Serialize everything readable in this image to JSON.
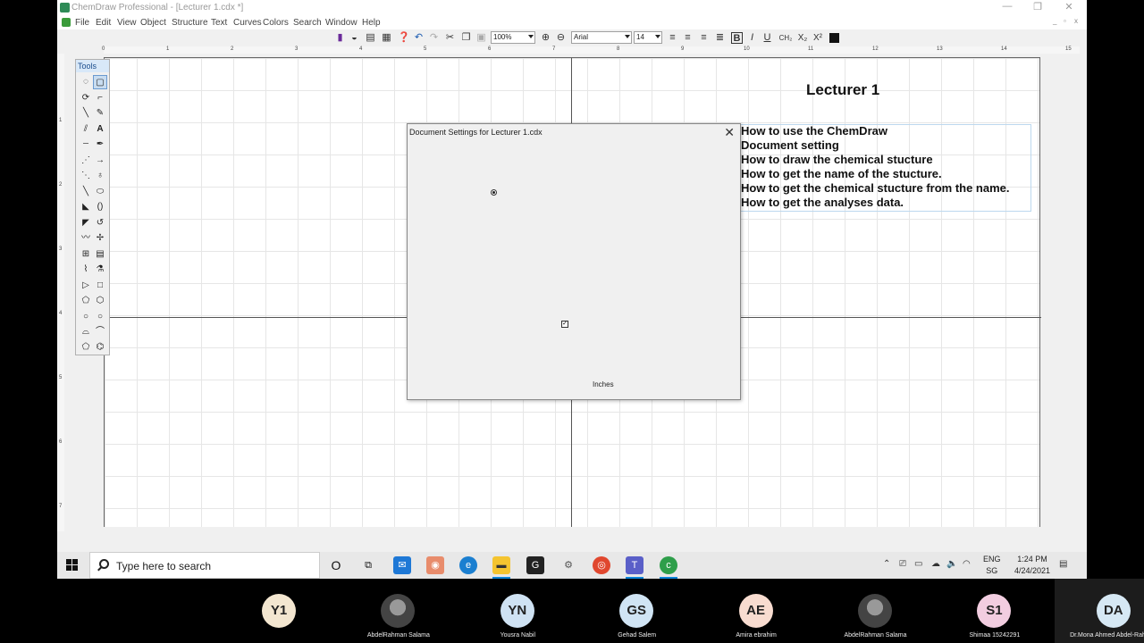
{
  "window": {
    "title": "ChemDraw Professional - [Lecturer 1.cdx *]",
    "controls": [
      "—",
      "❐",
      "✕"
    ]
  },
  "menu": [
    "File",
    "Edit",
    "View",
    "Object",
    "Structure",
    "Text",
    "Curves",
    "Colors",
    "Search",
    "Window",
    "Help"
  ],
  "toolbar": {
    "zoom": "100%",
    "font": "Arial",
    "size": "14",
    "style_bold": "B",
    "style_italic": "I",
    "style_underline": "U",
    "style_formula": "CH₂",
    "style_sub": "X₂",
    "style_sup": "X²"
  },
  "ruler": {
    "h": [
      "0",
      "1",
      "2",
      "3",
      "4",
      "5",
      "6",
      "7",
      "8",
      "9",
      "10",
      "11",
      "12",
      "13",
      "14",
      "15"
    ],
    "v": [
      "1",
      "2",
      "3",
      "4",
      "5",
      "6",
      "7"
    ]
  },
  "tools": {
    "header": "Tools"
  },
  "document": {
    "title": "Lecturer 1",
    "lines": [
      "How to use the ChemDraw",
      "Document setting",
      "How to draw the chemical stucture",
      "How to get the name of the stucture.",
      "How to get the chemical stucture from the name.",
      "How to get the analyses data."
    ]
  },
  "dialog": {
    "title": "Document Settings for Lecturer 1.cdx",
    "units": "Inches"
  },
  "taskbar": {
    "search_placeholder": "Type here to search",
    "lang1": "ENG",
    "lang2": "SG",
    "time": "1:24 PM",
    "date": "4/24/2021"
  },
  "participants": [
    {
      "initials": "Y1",
      "name": "",
      "color": "#f3e6d0"
    },
    {
      "initials": "",
      "name": "AbdelRahman Salama",
      "photo": true
    },
    {
      "initials": "YN",
      "name": "Yousra Nabil",
      "color": "#cfe2f3"
    },
    {
      "initials": "GS",
      "name": "Gehad Salem",
      "color": "#d0e4f4"
    },
    {
      "initials": "AE",
      "name": "Amira ebrahim",
      "color": "#f8dcd0"
    },
    {
      "initials": "",
      "name": "AbdelRahman Salama",
      "photo": true
    },
    {
      "initials": "S1",
      "name": "Shimaa 15242291",
      "color": "#f2cde0"
    },
    {
      "initials": "DA",
      "name": "Dr.Mona Ahmed Abdel-Rahman",
      "color": "#d6e8f4"
    }
  ]
}
